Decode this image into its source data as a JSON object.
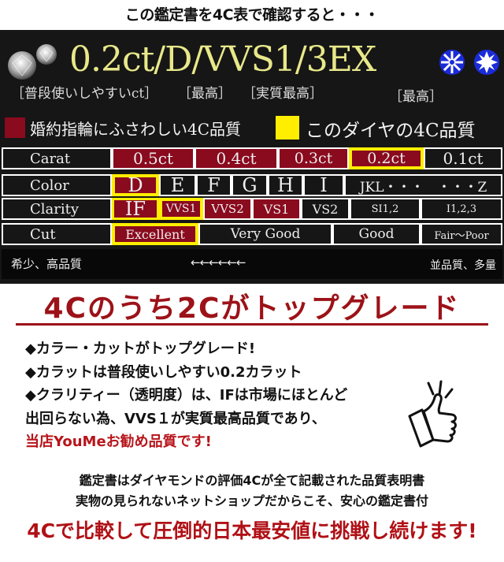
{
  "header": {
    "intro": "この鑑定書を4C表で確認すると・・・"
  },
  "spec": {
    "title": "0.2ct/D/VVS1/3EX",
    "notes": [
      "［普段使いしやすいct］",
      "［最高］",
      "［実質最高］",
      "［最高］"
    ],
    "icons": [
      "diamond-icon",
      "diamond-icon",
      "hearts-arrows-icon",
      "hearts-arrows-icon"
    ]
  },
  "legend": {
    "items": [
      {
        "label": "婚約指輪にふさわしい4C品質",
        "color": "#8a0a1e"
      },
      {
        "label": "このダイヤの4C品質",
        "color": "#ffee00"
      }
    ]
  },
  "grade_table": {
    "rows": [
      {
        "name": "Carat",
        "cells": [
          "0.5ct",
          "0.4ct",
          "0.3ct",
          "0.2ct",
          "0.1ct"
        ],
        "recommended": [
          true,
          true,
          true,
          true,
          false
        ],
        "selected": "0.2ct"
      },
      {
        "name": "Color",
        "cells": [
          "D",
          "E",
          "F",
          "G",
          "H",
          "I",
          "JKL・・・　・・・Z"
        ],
        "recommended": [
          true,
          false,
          false,
          false,
          false,
          false,
          false
        ],
        "selected": "D"
      },
      {
        "name": "Clarity",
        "cells": [
          "IF",
          "VVS1",
          "VVS2",
          "VS1",
          "VS2",
          "SI1,2",
          "I1,2,3"
        ],
        "recommended": [
          true,
          true,
          true,
          true,
          false,
          false,
          false
        ],
        "selected": "VVS1"
      },
      {
        "name": "Cut",
        "cells": [
          "Excellent",
          "Very Good",
          "Good",
          "Fair～Poor"
        ],
        "recommended": [
          true,
          false,
          false,
          false
        ],
        "selected": "Excellent"
      }
    ],
    "scale": {
      "left": "希少、高品質",
      "arrows": "←←←←←←",
      "right": "並品質、多量"
    }
  },
  "headline": "4Cのうち2Cがトップグレード",
  "bullets": [
    "◆カラー・カットがトップグレード!",
    "◆カラットは普段使いしやすい0.2カラット",
    "◆クラリティー（透明度）は、IFは市場にほとんど",
    "出回らない為、VVS１が実質最高品質であり、"
  ],
  "recommend_line": "当店YouMeお勧め品質です!",
  "notes": [
    "鑑定書はダイヤモンドの評価4Cが全て記載された品質表明書",
    "実物の見られないネットショップだからこそ、安心の鑑定書付"
  ],
  "closing": "4Cで比較して圧倒的日本最安値に挑戦し続けます!",
  "colors": {
    "accent_red": "#8a0a1e",
    "highlight_yellow": "#ffee00",
    "title_yellow": "#e8e88a",
    "headline_red": "#9c1218"
  }
}
